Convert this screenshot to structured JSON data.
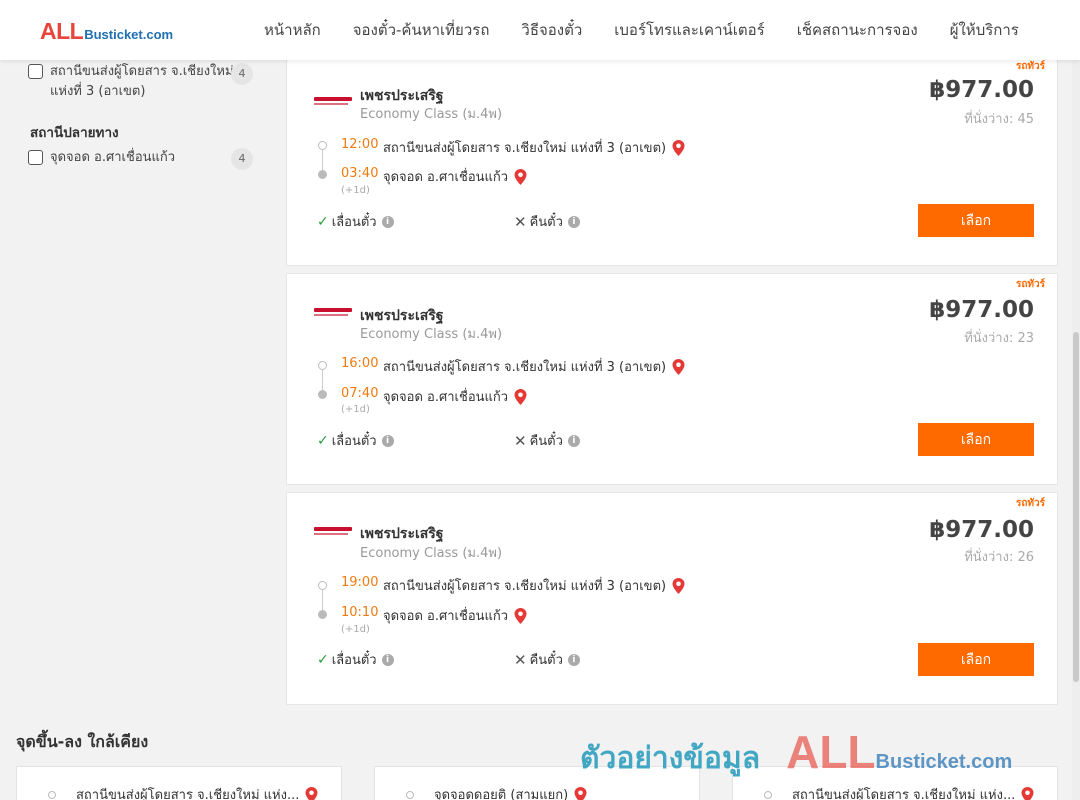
{
  "header": {
    "logo_all": "ALL",
    "logo_busticket": "Busticket.com",
    "nav": [
      "หน้าหลัก",
      "จองตั๋ว-ค้นหาเที่ยวรถ",
      "วิธีจองตั๋ว",
      "เบอร์โทรและเคาน์เตอร์",
      "เช็คสถานะการจอง",
      "ผู้ให้บริการ"
    ]
  },
  "sidebar": {
    "origin_item": {
      "label": "สถานีขนส่งผู้โดยสาร จ.เชียงใหม่ แห่งที่ 3 (อาเขต)",
      "count": "4"
    },
    "destination_title": "สถานีปลายทาง",
    "destination_item": {
      "label": "จุดจอด อ.ศาเชื่อนแก้ว",
      "count": "4"
    }
  },
  "trips": [
    {
      "badge": "รถทัวร์",
      "operator": "เพชรประเสริฐ",
      "class": "Economy Class (ม.4พ)",
      "price": "฿977.00",
      "seats": "ที่นั่งว่าง: 45",
      "depart_time": "12:00",
      "depart_stop": "สถานีขนส่งผู้โดยสาร จ.เชียงใหม่ แห่งที่ 3 (อาเขต)",
      "arrive_time": "03:40",
      "arrive_stop": "จุดจอด อ.ศาเชื่อนแก้ว",
      "next_day": "(+1d)",
      "reschedule": "เลื่อนตั๋ว",
      "refund": "คืนตั๋ว",
      "select": "เลือก"
    },
    {
      "badge": "รถทัวร์",
      "operator": "เพชรประเสริฐ",
      "class": "Economy Class (ม.4พ)",
      "price": "฿977.00",
      "seats": "ที่นั่งว่าง: 23",
      "depart_time": "16:00",
      "depart_stop": "สถานีขนส่งผู้โดยสาร จ.เชียงใหม่ แห่งที่ 3 (อาเขต)",
      "arrive_time": "07:40",
      "arrive_stop": "จุดจอด อ.ศาเชื่อนแก้ว",
      "next_day": "(+1d)",
      "reschedule": "เลื่อนตั๋ว",
      "refund": "คืนตั๋ว",
      "select": "เลือก"
    },
    {
      "badge": "รถทัวร์",
      "operator": "เพชรประเสริฐ",
      "class": "Economy Class (ม.4พ)",
      "price": "฿977.00",
      "seats": "ที่นั่งว่าง: 26",
      "depart_time": "19:00",
      "depart_stop": "สถานีขนส่งผู้โดยสาร จ.เชียงใหม่ แห่งที่ 3 (อาเขต)",
      "arrive_time": "10:10",
      "arrive_stop": "จุดจอด อ.ศาเชื่อนแก้ว",
      "next_day": "(+1d)",
      "reschedule": "เลื่อนตั๋ว",
      "refund": "คืนตั๋ว",
      "select": "เลือก"
    }
  ],
  "nearby": {
    "title": "จุดขึ้น-ลง ใกล้เคียง",
    "items": [
      "สถานีขนส่งผู้โดยสาร จ.เชียงใหม่ แห่ง...",
      "จุดจอดดอยติ (สามแยก)",
      "สถานีขนส่งผู้โดยสาร จ.เชียงใหม่ แห่ง..."
    ]
  },
  "watermark": {
    "text": "ตัวอย่างข้อมูล",
    "all": "ALL",
    "busticket": "Busticket.com"
  },
  "colors": {
    "accent": "#ff6a00",
    "time": "#f07a10",
    "brand_red": "#e8453c",
    "brand_blue": "#1f6fb2",
    "check_green": "#2a9d3a"
  }
}
